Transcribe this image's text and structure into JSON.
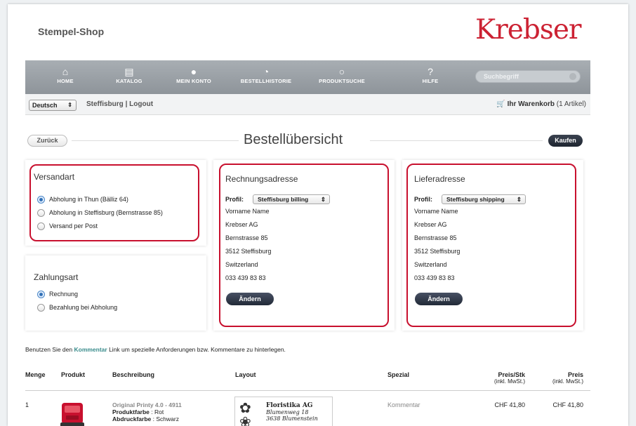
{
  "header": {
    "shop_title": "Stempel-Shop",
    "logo": "Krebser"
  },
  "nav": {
    "items": [
      {
        "icon": "home-icon",
        "glyph": "⌂",
        "label": "HOME"
      },
      {
        "icon": "catalog-icon",
        "glyph": "▤",
        "label": "KATALOG"
      },
      {
        "icon": "user-icon",
        "glyph": "●",
        "label": "MEIN KONTO"
      },
      {
        "icon": "history-icon",
        "glyph": "◔",
        "label": "BESTELLHISTORIE"
      },
      {
        "icon": "search-icon",
        "glyph": "○",
        "label": "PRODUKTSUCHE"
      },
      {
        "icon": "help-icon",
        "glyph": "?",
        "label": "HILFE"
      }
    ],
    "search_placeholder": "Suchbegriff"
  },
  "subbar": {
    "language": "Deutsch",
    "location": "Steffisburg",
    "separator": "|",
    "logout": "Logout",
    "cart_label": "Ihr Warenkorb",
    "cart_count": "(1 Artikel)"
  },
  "page": {
    "back": "Zurück",
    "title": "Bestellübersicht",
    "buy": "Kaufen"
  },
  "shipping": {
    "title": "Versandart",
    "options": [
      {
        "label": "Abholung in Thun (Bälliz 64)",
        "selected": true
      },
      {
        "label": "Abholung in Steffisburg (Bernstrasse 85)",
        "selected": false
      },
      {
        "label": "Versand per Post",
        "selected": false
      }
    ]
  },
  "payment": {
    "title": "Zahlungsart",
    "options": [
      {
        "label": "Rechnung",
        "selected": true
      },
      {
        "label": "Bezahlung bei Abholung",
        "selected": false
      }
    ]
  },
  "billing": {
    "title": "Rechnungsadresse",
    "profile_label": "Profil:",
    "profile_value": "Steffisburg billing",
    "lines": [
      "Vorname Name",
      "Krebser AG",
      "Bernstrasse 85",
      "3512 Steffisburg",
      "Switzerland",
      "033 439 83 83"
    ],
    "edit": "Ändern"
  },
  "delivery": {
    "title": "Lieferadresse",
    "profile_label": "Profil:",
    "profile_value": "Steffisburg shipping",
    "lines": [
      "Vorname Name",
      "Krebser AG",
      "Bernstrasse 85",
      "3512 Steffisburg",
      "Switzerland",
      "033 439 83 83"
    ],
    "edit": "Ändern"
  },
  "note": {
    "before": "Benutzen Sie den ",
    "link": "Kommentar",
    "after": " Link um spezielle Anforderungen bzw. Kommentare zu hinterlegen."
  },
  "table": {
    "headers": {
      "qty": "Menge",
      "product": "Produkt",
      "description": "Beschreibung",
      "layout": "Layout",
      "special": "Spezial",
      "unit_price": "Preis/Stk",
      "unit_price_sub": "(inkl. MwSt.)",
      "price": "Preis",
      "price_sub": "(inkl. MwSt.)"
    },
    "rows": [
      {
        "qty": "1",
        "name": "Original Printy 4.0 - 4911",
        "attr1_label": "Produktfarbe",
        "attr1_value": "Rot",
        "attr2_label": "Abdruckfarbe",
        "attr2_value": "Schwarz",
        "layout_line1": "Floristika AG",
        "layout_line2": "Blumenweg 18",
        "layout_line3": "3638 Blumenstein",
        "special": "Kommentar",
        "unit_price": "CHF 41,80",
        "price": "CHF 41,80"
      }
    ]
  }
}
